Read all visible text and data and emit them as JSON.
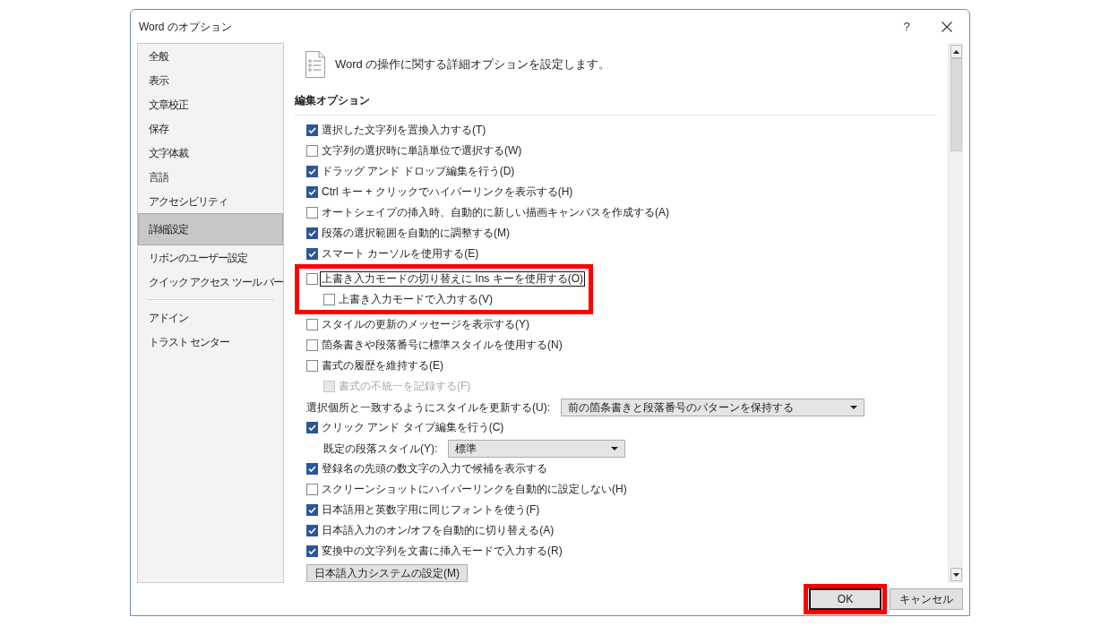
{
  "window": {
    "title": "Word のオプション",
    "help_button": "?"
  },
  "sidebar": {
    "groups": [
      {
        "items": [
          {
            "label": "全般",
            "selected": false
          },
          {
            "label": "表示",
            "selected": false
          },
          {
            "label": "文章校正",
            "selected": false
          },
          {
            "label": "保存",
            "selected": false
          },
          {
            "label": "文字体裁",
            "selected": false
          },
          {
            "label": "言語",
            "selected": false
          },
          {
            "label": "アクセシビリティ",
            "selected": false
          },
          {
            "label": "詳細設定",
            "selected": true
          },
          {
            "label": "リボンのユーザー設定",
            "selected": false
          },
          {
            "label": "クイック アクセス ツール バー",
            "selected": false
          }
        ]
      },
      {
        "items": [
          {
            "label": "アドイン",
            "selected": false
          },
          {
            "label": "トラスト センター",
            "selected": false
          }
        ]
      }
    ]
  },
  "main": {
    "heading": "Word の操作に関する詳細オプションを設定します。",
    "section": {
      "title": "編集オプション",
      "options": [
        {
          "kind": "checkbox",
          "label": "選択した文字列を置換入力する(T)",
          "checked": true,
          "disabled": false,
          "focused": false
        },
        {
          "kind": "checkbox",
          "label": "文字列の選択時に単語単位で選択する(W)",
          "checked": false,
          "disabled": false,
          "focused": false
        },
        {
          "kind": "checkbox",
          "label": "ドラッグ アンド ドロップ編集を行う(D)",
          "checked": true,
          "disabled": false,
          "focused": false
        },
        {
          "kind": "checkbox",
          "label": "Ctrl キー + クリックでハイパーリンクを表示する(H)",
          "checked": true,
          "disabled": false,
          "focused": false
        },
        {
          "kind": "checkbox",
          "label": "オートシェイプの挿入時、自動的に新しい描画キャンバスを作成する(A)",
          "checked": false,
          "disabled": false,
          "focused": false
        },
        {
          "kind": "checkbox",
          "label": "段落の選択範囲を自動的に調整する(M)",
          "checked": true,
          "disabled": false,
          "focused": false
        },
        {
          "kind": "checkbox",
          "label": "スマート カーソルを使用する(E)",
          "checked": true,
          "disabled": false,
          "focused": false
        },
        {
          "kind": "annotation_frame",
          "items": [
            {
              "kind": "checkbox",
              "label": "上書き入力モードの切り替えに Ins キーを使用する(O)",
              "checked": false,
              "disabled": false,
              "focused": true,
              "children": [
                {
                  "kind": "checkbox",
                  "label": "上書き入力モードで入力する(V)",
                  "checked": false,
                  "disabled": false,
                  "focused": false
                }
              ]
            }
          ]
        },
        {
          "kind": "checkbox",
          "label": "スタイルの更新のメッセージを表示する(Y)",
          "checked": false,
          "disabled": false,
          "focused": false
        },
        {
          "kind": "checkbox",
          "label": "箇条書きや段落番号に標準スタイルを使用する(N)",
          "checked": false,
          "disabled": false,
          "focused": false
        },
        {
          "kind": "checkbox",
          "label": "書式の履歴を維持する(E)",
          "checked": false,
          "disabled": false,
          "focused": false,
          "children": [
            {
              "kind": "checkbox",
              "label": "書式の不統一を記録する(F)",
              "checked": false,
              "disabled": true,
              "focused": false
            }
          ]
        },
        {
          "kind": "dropdown",
          "label": "選択個所と一致するようにスタイルを更新する(U):",
          "value": "前の箇条書きと段落番号のパターンを保持する"
        },
        {
          "kind": "checkbox",
          "label": "クリック アンド タイプ編集を行う(C)",
          "checked": true,
          "disabled": false,
          "focused": false,
          "children": [
            {
              "kind": "dropdown",
              "label": "既定の段落スタイル(Y):",
              "value": "標準"
            }
          ]
        },
        {
          "kind": "checkbox",
          "label": "登録名の先頭の数文字の入力で候補を表示する",
          "checked": true,
          "disabled": false,
          "focused": false
        },
        {
          "kind": "checkbox",
          "label": "スクリーンショットにハイパーリンクを自動的に設定しない(H)",
          "checked": false,
          "disabled": false,
          "focused": false
        },
        {
          "kind": "checkbox",
          "label": "日本語用と英数字用に同じフォントを使う(F)",
          "checked": true,
          "disabled": false,
          "focused": false
        },
        {
          "kind": "checkbox",
          "label": "日本語入力のオン/オフを自動的に切り替える(A)",
          "checked": true,
          "disabled": false,
          "focused": false
        },
        {
          "kind": "checkbox",
          "label": "変換中の文字列を文書に挿入モードで入力する(R)",
          "checked": true,
          "disabled": false,
          "focused": false
        },
        {
          "kind": "button",
          "label": "日本語入力システムの設定(M)"
        }
      ]
    }
  },
  "buttons": [
    {
      "label": "OK",
      "default": true,
      "annotated": true
    },
    {
      "label": "キャンセル",
      "default": false,
      "annotated": false
    }
  ]
}
